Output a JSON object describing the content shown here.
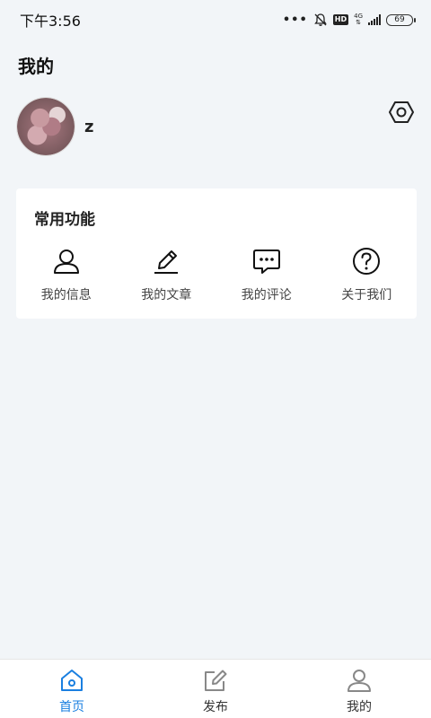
{
  "status_bar": {
    "time": "下午3:56",
    "dots": "•••",
    "hd": "HD",
    "network": "4G",
    "battery": "69"
  },
  "page": {
    "title": "我的"
  },
  "profile": {
    "username": "z"
  },
  "common_functions": {
    "title": "常用功能",
    "items": [
      {
        "label": "我的信息",
        "icon": "person-icon"
      },
      {
        "label": "我的文章",
        "icon": "pencil-icon"
      },
      {
        "label": "我的评论",
        "icon": "comment-icon"
      },
      {
        "label": "关于我们",
        "icon": "question-icon"
      }
    ]
  },
  "bottom_nav": {
    "items": [
      {
        "label": "首页",
        "icon": "home-icon",
        "active": true
      },
      {
        "label": "发布",
        "icon": "edit-icon",
        "active": false
      },
      {
        "label": "我的",
        "icon": "person-icon",
        "active": false
      }
    ]
  },
  "colors": {
    "accent": "#1a7fe0",
    "background": "#f2f5f8",
    "card": "#ffffff"
  }
}
